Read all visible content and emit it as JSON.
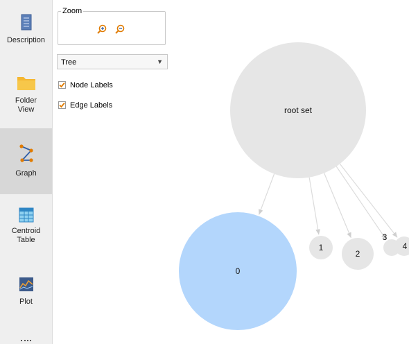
{
  "sidebar": {
    "items": [
      {
        "label": "Description",
        "icon": "document-icon"
      },
      {
        "label": "Folder\nView",
        "icon": "folder-icon"
      },
      {
        "label": "Graph",
        "icon": "graph-icon",
        "active": true
      },
      {
        "label": "Centroid\nTable",
        "icon": "table-icon"
      },
      {
        "label": "Plot",
        "icon": "plot-icon"
      }
    ]
  },
  "controls": {
    "zoom_label": "Zoom",
    "layout_select": {
      "value": "Tree"
    },
    "node_labels": {
      "label": "Node Labels",
      "checked": true
    },
    "edge_labels": {
      "label": "Edge Labels",
      "checked": true
    }
  },
  "graph": {
    "nodes": [
      {
        "id": "root",
        "label": "root set",
        "color": "#e6e6e6"
      },
      {
        "id": "n0",
        "label": "0",
        "color": "#b3d6fc"
      },
      {
        "id": "n1",
        "label": "1",
        "color": "#e6e6e6"
      },
      {
        "id": "n2",
        "label": "2",
        "color": "#e6e6e6"
      },
      {
        "id": "n3",
        "label": "3",
        "color": "#e6e6e6"
      },
      {
        "id": "n4",
        "label": "4",
        "color": "#e6e6e6"
      }
    ],
    "edges": [
      {
        "from": "root",
        "to": "n0"
      },
      {
        "from": "root",
        "to": "n1"
      },
      {
        "from": "root",
        "to": "n2"
      },
      {
        "from": "root",
        "to": "n3"
      },
      {
        "from": "root",
        "to": "n4"
      }
    ]
  },
  "colors": {
    "accent": "#e07b00",
    "selected_node": "#b3d6fc",
    "node": "#e6e6e6"
  }
}
